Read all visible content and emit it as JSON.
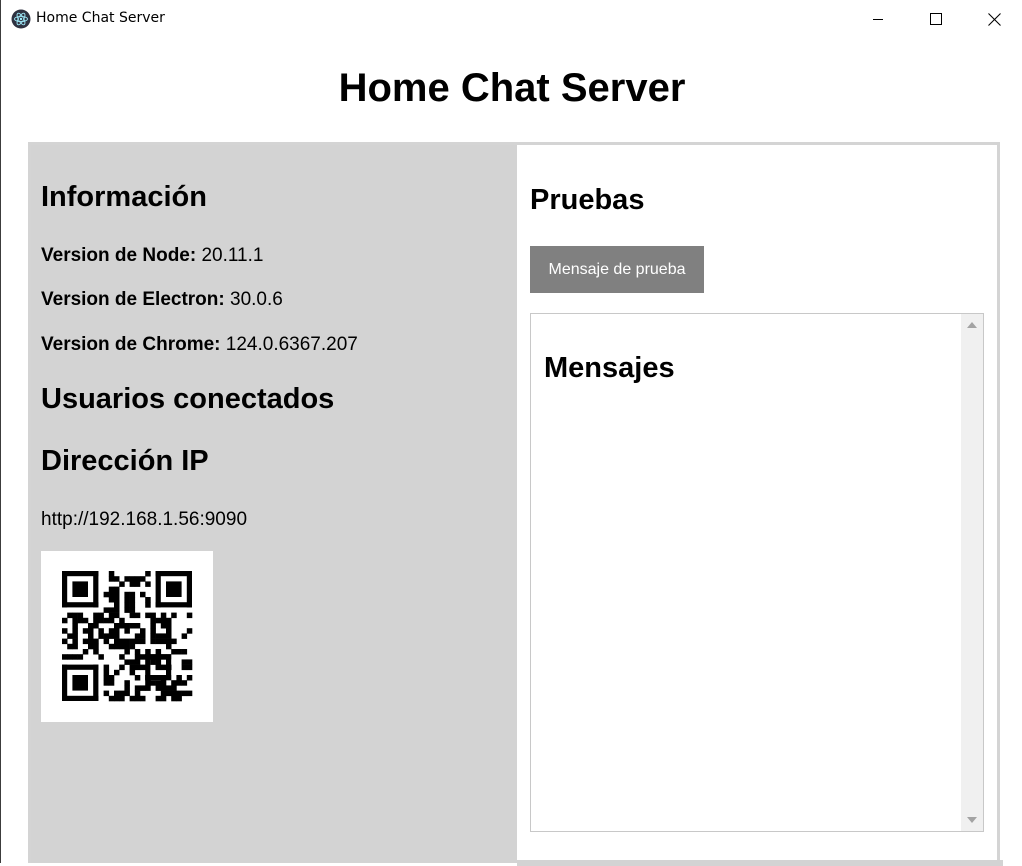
{
  "window": {
    "title": "Home Chat Server",
    "controls": [
      "minimize-icon",
      "maximize-icon",
      "close-icon"
    ]
  },
  "page": {
    "title": "Home Chat Server"
  },
  "info": {
    "heading": "Información",
    "node_label": "Version de Node:",
    "node_value": "20.11.1",
    "electron_label": "Version de Electron:",
    "electron_value": "30.0.6",
    "chrome_label": "Version de Chrome:",
    "chrome_value": "124.0.6367.207"
  },
  "users": {
    "heading": "Usuarios conectados"
  },
  "ip": {
    "heading": "Dirección IP",
    "address": "http://192.168.1.56:9090",
    "qr_icon": "qr-code-icon"
  },
  "tests": {
    "heading": "Pruebas",
    "button_label": "Mensaje de prueba"
  },
  "messages": {
    "heading": "Mensajes"
  },
  "colors": {
    "left_panel_bg": "#d3d3d3",
    "button_bg": "#808080",
    "button_text": "#ffffff"
  }
}
